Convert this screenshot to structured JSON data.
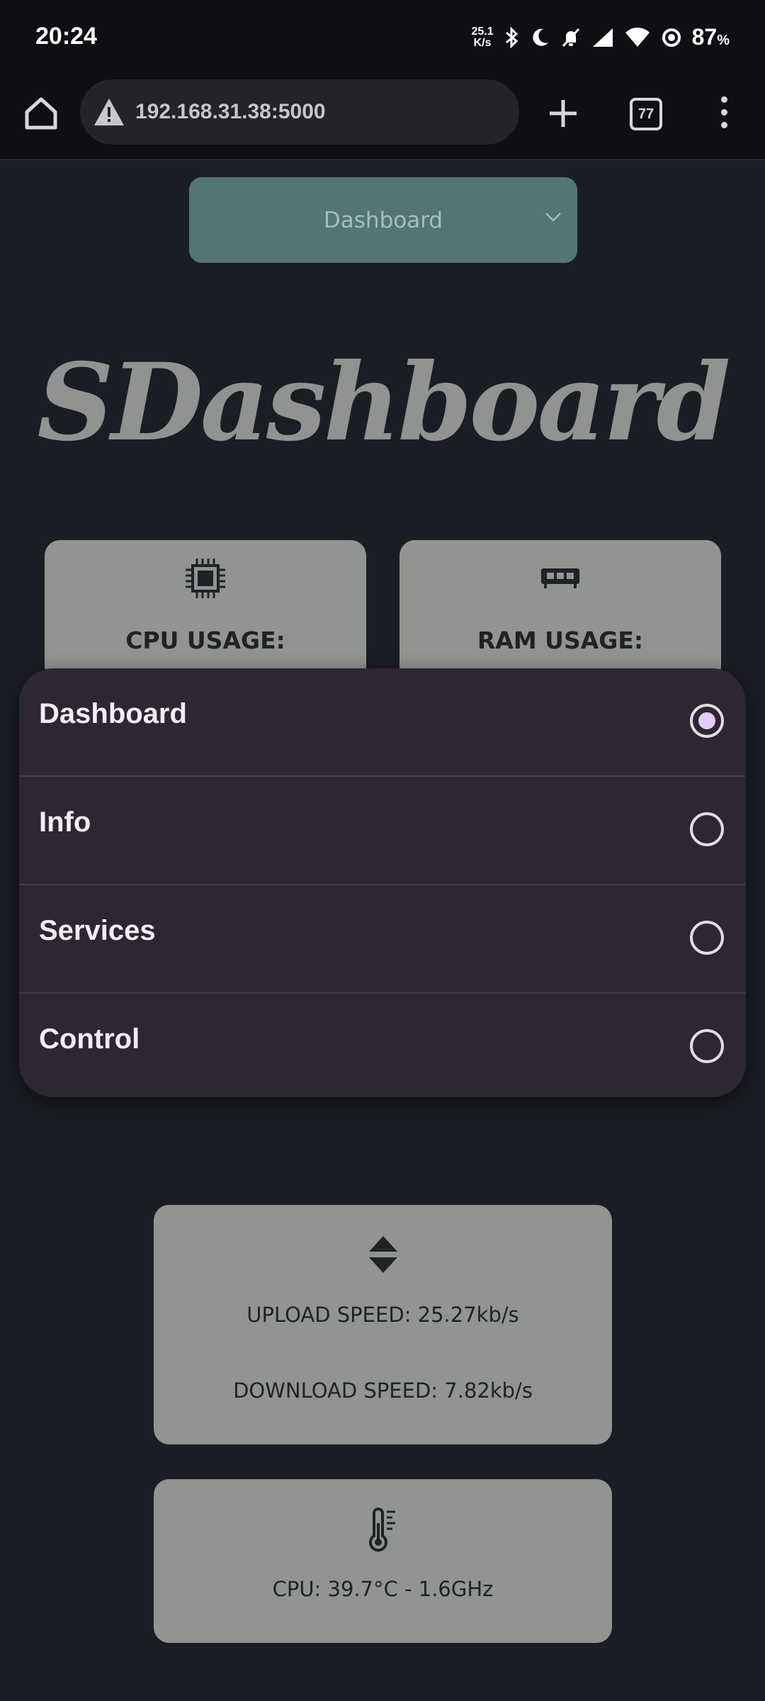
{
  "status_bar": {
    "time": "20:24",
    "net_speed_value": "25.1",
    "net_speed_unit": "K/s",
    "battery_percent": "87",
    "battery_unit": "%"
  },
  "browser": {
    "url": "192.168.31.38:5000",
    "tab_count": "77"
  },
  "page": {
    "select_value": "Dashboard",
    "brand_title": "SDashboard",
    "cpu_card_label": "CPU USAGE:",
    "ram_card_label": "RAM USAGE:",
    "upload_speed": "UPLOAD SPEED: 25.27kb/s",
    "download_speed": "DOWNLOAD SPEED: 7.82kb/s",
    "cpu_temp": "CPU: 39.7°C - 1.6GHz"
  },
  "dropdown": {
    "options": [
      {
        "label": "Dashboard",
        "selected": true
      },
      {
        "label": "Info",
        "selected": false
      },
      {
        "label": "Services",
        "selected": false
      },
      {
        "label": "Control",
        "selected": false
      }
    ]
  },
  "colors": {
    "background": "#1a1d23",
    "card": "#929491",
    "select": "#527575",
    "dropdown": "#2c2733",
    "radio_selected": "#e6ccfa"
  }
}
